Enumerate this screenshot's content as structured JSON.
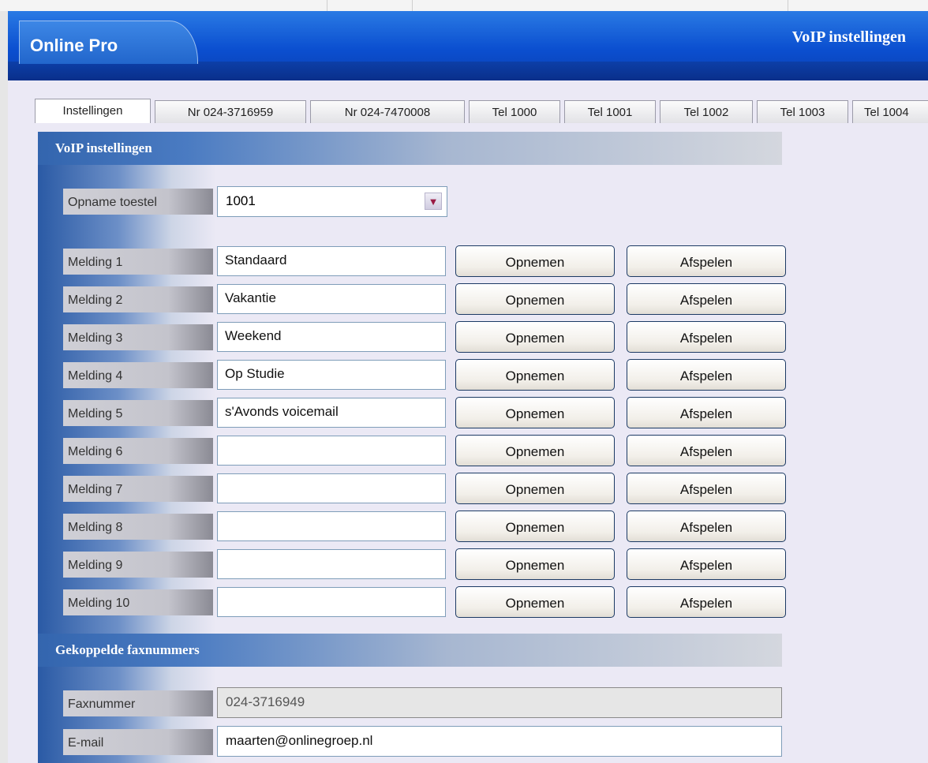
{
  "app": {
    "title": "Online Pro",
    "page_heading": "VoIP instellingen"
  },
  "tabs": [
    {
      "label": "Instellingen",
      "active": true
    },
    {
      "label": "Nr 024-3716959"
    },
    {
      "label": "Nr 024-7470008"
    },
    {
      "label": "Tel 1000"
    },
    {
      "label": "Tel 1001"
    },
    {
      "label": "Tel 1002"
    },
    {
      "label": "Tel 1003"
    },
    {
      "label": "Tel 1004"
    }
  ],
  "voip": {
    "section_title": "VoIP  instellingen",
    "opname_label": "Opname toestel",
    "opname_value": "1001",
    "melding_rows": [
      {
        "label": "Melding 1",
        "value": "Standaard"
      },
      {
        "label": "Melding 2",
        "value": "Vakantie"
      },
      {
        "label": "Melding 3",
        "value": "Weekend"
      },
      {
        "label": "Melding 4",
        "value": "Op Studie"
      },
      {
        "label": "Melding 5",
        "value": "s'Avonds voicemail"
      },
      {
        "label": "Melding 6",
        "value": ""
      },
      {
        "label": "Melding 7",
        "value": ""
      },
      {
        "label": "Melding 8",
        "value": ""
      },
      {
        "label": "Melding 9",
        "value": ""
      },
      {
        "label": "Melding 10",
        "value": ""
      }
    ],
    "record_label": "Opnemen",
    "play_label": "Afspelen"
  },
  "fax": {
    "section_title": "Gekoppelde faxnummers",
    "faxnummer_label": "Faxnummer",
    "faxnummer_value": "024-3716949",
    "email_label": "E-mail",
    "email_value": "maarten@onlinegroep.nl"
  },
  "colors": {
    "header_blue": "#0b4fd0",
    "button_border": "#1c3a64",
    "arrow_red": "#9a1a44"
  },
  "icons": {
    "dropdown": "chevron-down-icon"
  }
}
